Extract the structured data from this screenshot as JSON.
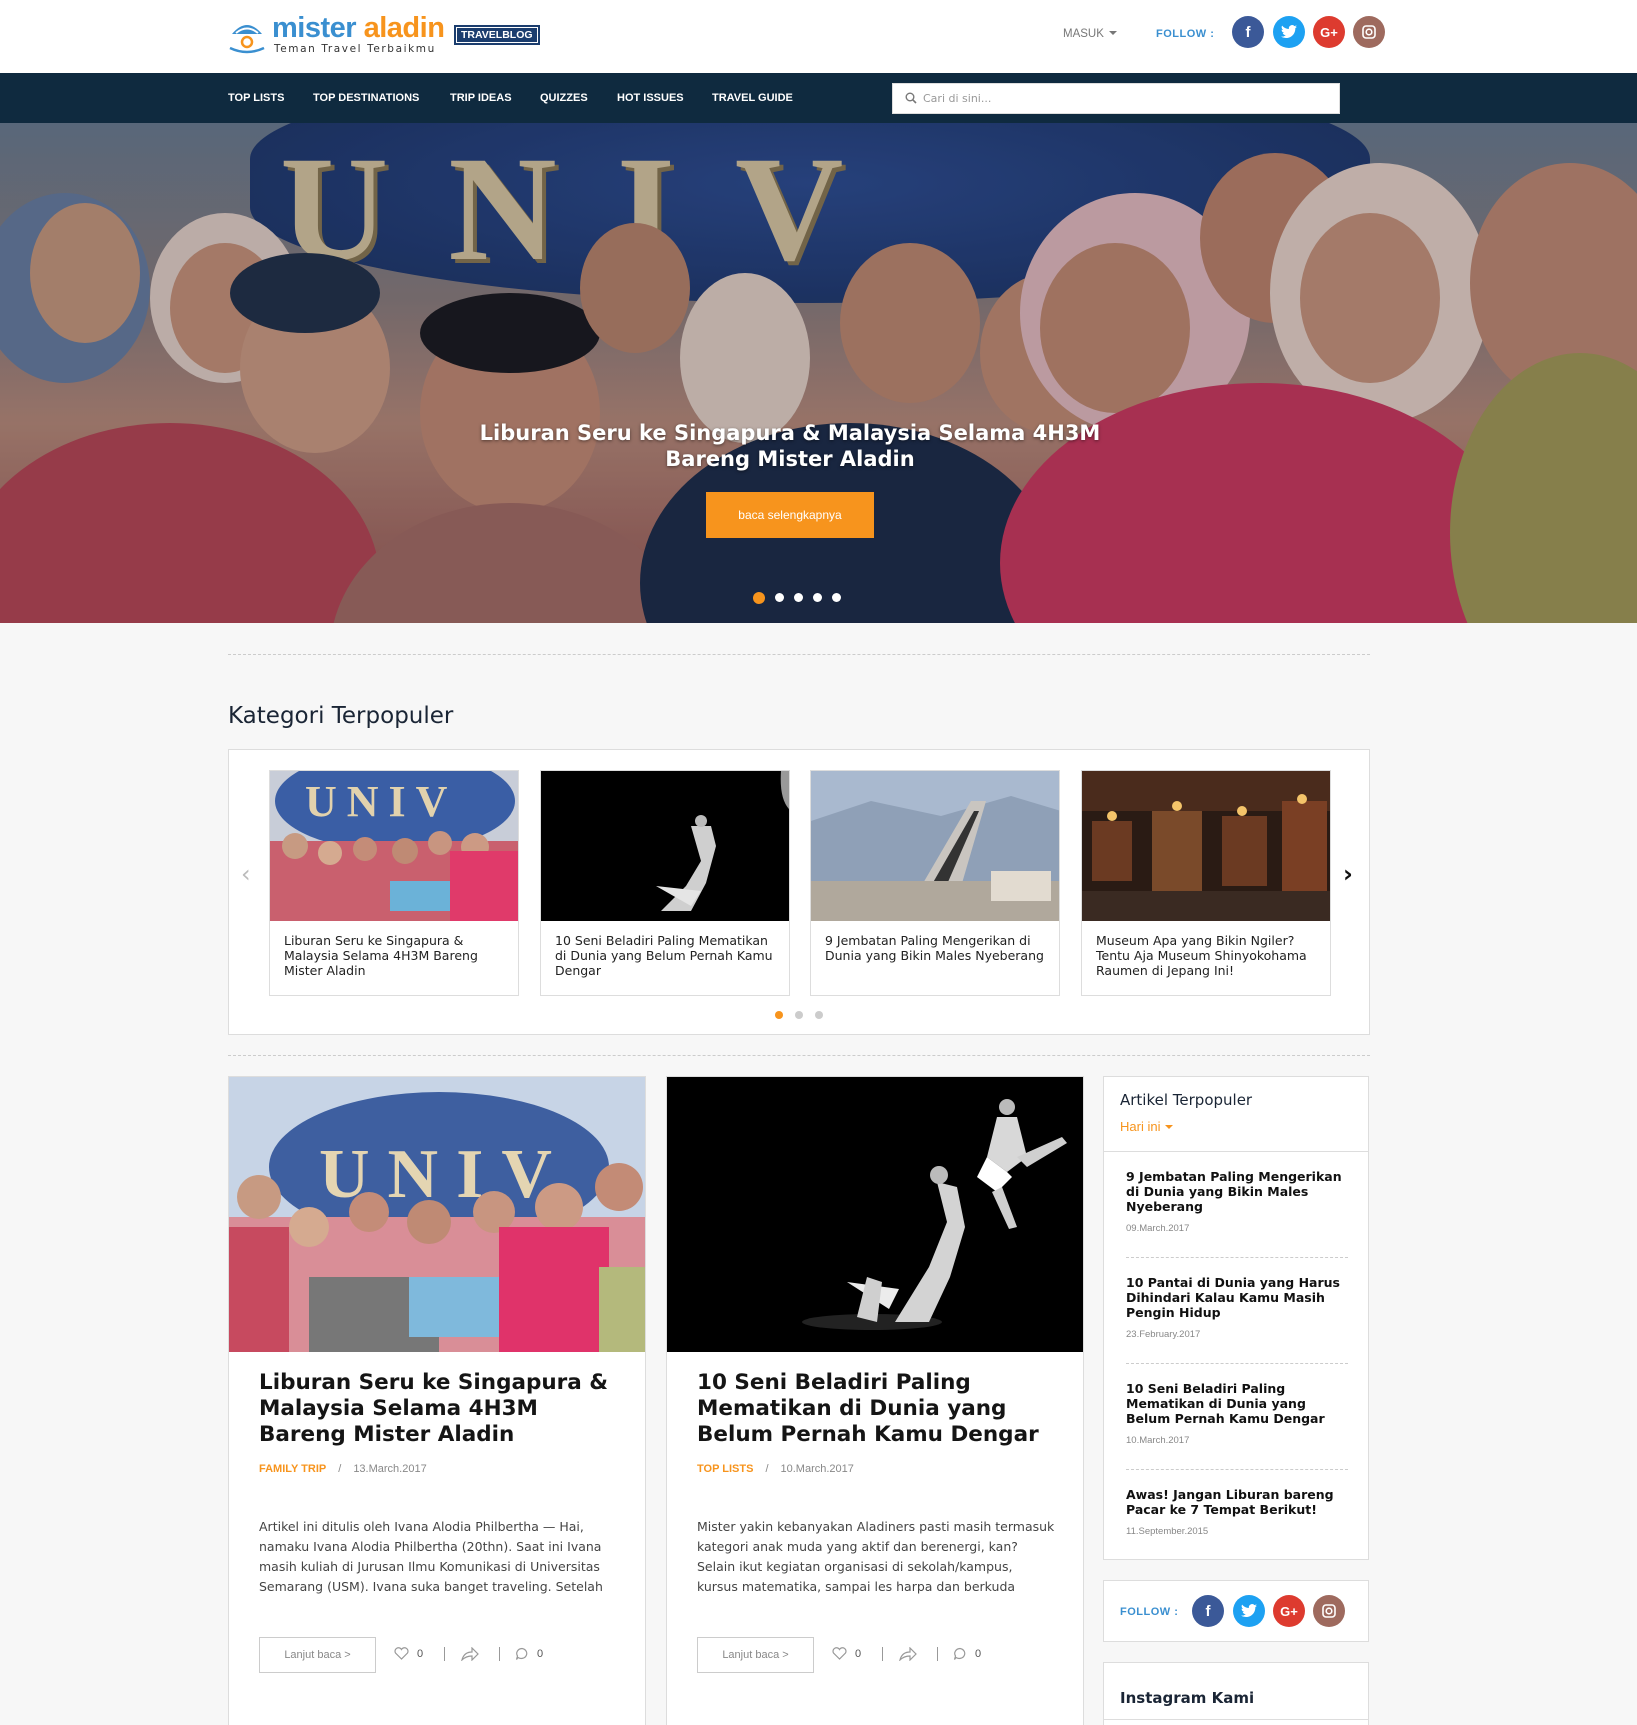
{
  "brand": {
    "name_part1": "mister",
    "name_part2": "aladin",
    "tagline": "Teman Travel Terbaikmu",
    "badge": "TRAVELBLOG"
  },
  "header": {
    "login_label": "MASUK",
    "follow_label": "FOLLOW :",
    "social": [
      {
        "icon": "facebook-icon",
        "glyph": "f",
        "color": "#3b5998"
      },
      {
        "icon": "twitter-icon",
        "glyph": "t",
        "color": "#1da1f2"
      },
      {
        "icon": "google-plus-icon",
        "glyph": "G+",
        "color": "#dd3b2f"
      },
      {
        "icon": "instagram-icon",
        "glyph": "◎",
        "color": "#9e6a5e"
      }
    ]
  },
  "nav": {
    "items": [
      "TOP LISTS",
      "TOP DESTINATIONS",
      "TRIP IDEAS",
      "QUIZZES",
      "HOT ISSUES",
      "TRAVEL GUIDE"
    ],
    "search_placeholder": "Cari di sini..."
  },
  "hero": {
    "title": "Liburan Seru ke Singapura & Malaysia Selama 4H3M Bareng Mister Aladin",
    "button_label": "baca selengkapnya",
    "slide_count": 5,
    "active_slide": 1
  },
  "categories": {
    "heading": "Kategori Terpopuler",
    "cards": [
      {
        "title": "Liburan Seru ke Singapura & Malaysia Selama 4H3M Bareng Mister Aladin"
      },
      {
        "title": "10 Seni Beladiri Paling Mematikan di Dunia yang Belum Pernah Kamu Dengar"
      },
      {
        "title": "9 Jembatan Paling Mengerikan di Dunia yang Bikin Males Nyeberang"
      },
      {
        "title": "Museum Apa yang Bikin Ngiler? Tentu Aja Museum Shinyokohama Raumen di Jepang Ini!"
      }
    ],
    "page_count": 3,
    "active_page": 1
  },
  "articles": [
    {
      "title": "Liburan Seru ke Singapura & Malaysia Selama 4H3M Bareng Mister Aladin",
      "category": "FAMILY TRIP",
      "separator": "/",
      "date": "13.March.2017",
      "excerpt": "Artikel ini ditulis oleh Ivana Alodia Philbertha — Hai, namaku Ivana Alodia Philbertha (20thn). Saat ini Ivana masih kuliah di Jurusan Ilmu Komunikasi di Universitas Semarang (USM). Ivana suka banget traveling. Setelah",
      "read_more": "Lanjut baca >",
      "likes": "0",
      "comments": "0"
    },
    {
      "title": "10 Seni Beladiri Paling Mematikan di Dunia yang Belum Pernah Kamu Dengar",
      "category": "TOP LISTS",
      "separator": "/",
      "date": "10.March.2017",
      "excerpt": "Mister yakin kebanyakan Aladiners pasti masih termasuk kategori anak muda yang aktif dan berenergi, kan? Selain ikut kegiatan organisasi di sekolah/kampus, kursus matematika, sampai les harpa dan berkuda",
      "read_more": "Lanjut baca >",
      "likes": "0",
      "comments": "0"
    }
  ],
  "sidebar": {
    "popular_heading": "Artikel Terpopuler",
    "filter_label": "Hari ini",
    "popular": [
      {
        "title": "9 Jembatan Paling Mengerikan di Dunia yang Bikin Males Nyeberang",
        "date": "09.March.2017"
      },
      {
        "title": "10 Pantai di Dunia yang Harus Dihindari Kalau Kamu Masih Pengin Hidup",
        "date": "23.February.2017"
      },
      {
        "title": "10 Seni Beladiri Paling Mematikan di Dunia yang Belum Pernah Kamu Dengar",
        "date": "10.March.2017"
      },
      {
        "title": "Awas! Jangan Liburan bareng Pacar ke 7 Tempat Berikut!",
        "date": "11.September.2015"
      }
    ],
    "follow_label": "FOLLOW :",
    "instagram_heading": "Instagram Kami"
  },
  "colors": {
    "accent": "#f7941d",
    "nav_bg": "#0f2a3f",
    "brand_blue": "#3a8fd0"
  }
}
